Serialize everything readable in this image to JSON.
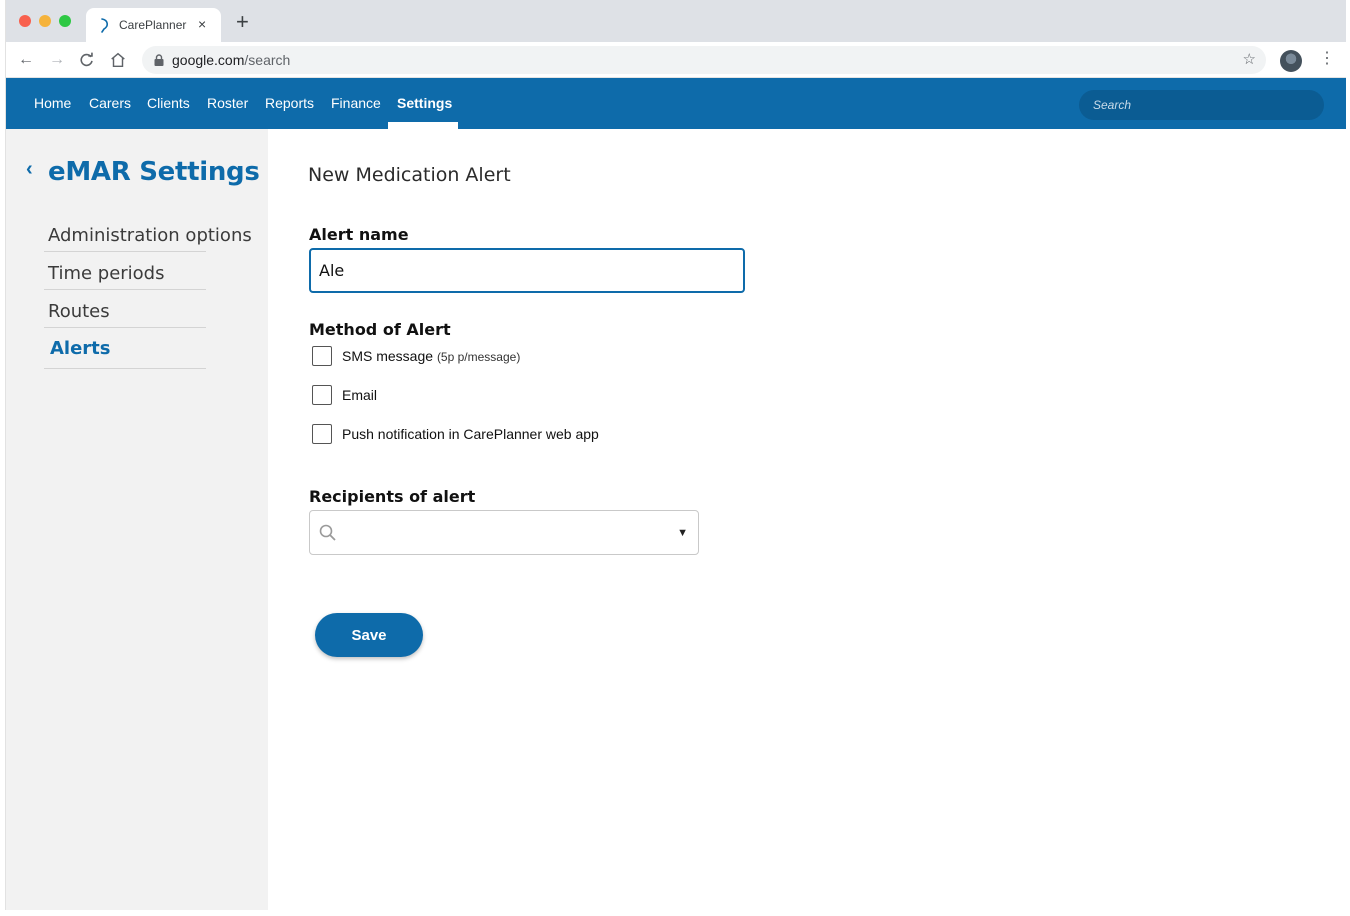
{
  "browser": {
    "tab_title": "CarePlanner",
    "tab_close": "×",
    "new_tab": "+",
    "url_host": "google.com",
    "url_path": "/search"
  },
  "appnav": {
    "items": [
      {
        "label": "Home"
      },
      {
        "label": "Carers"
      },
      {
        "label": "Clients"
      },
      {
        "label": "Roster"
      },
      {
        "label": "Reports"
      },
      {
        "label": "Finance"
      },
      {
        "label": "Settings",
        "active": true
      }
    ],
    "search_placeholder": "Search",
    "accent_color": "#0e6baa"
  },
  "sidebar": {
    "back_symbol": "‹",
    "title": "eMAR Settings",
    "items": [
      {
        "label": "Administration options"
      },
      {
        "label": "Time periods"
      },
      {
        "label": "Routes"
      },
      {
        "label": "Alerts",
        "active": true
      }
    ]
  },
  "form": {
    "page_title": "New Medication Alert",
    "alert_name_label": "Alert name",
    "alert_name_value": "Ale",
    "method_label": "Method of Alert",
    "methods": [
      {
        "label": "SMS message",
        "note": "(5p p/message)",
        "checked": false
      },
      {
        "label": "Email",
        "note": "",
        "checked": false
      },
      {
        "label": "Push notification in CarePlanner web app",
        "note": "",
        "checked": false
      }
    ],
    "recipients_label": "Recipients of alert",
    "recipients_value": "",
    "save_label": "Save"
  }
}
